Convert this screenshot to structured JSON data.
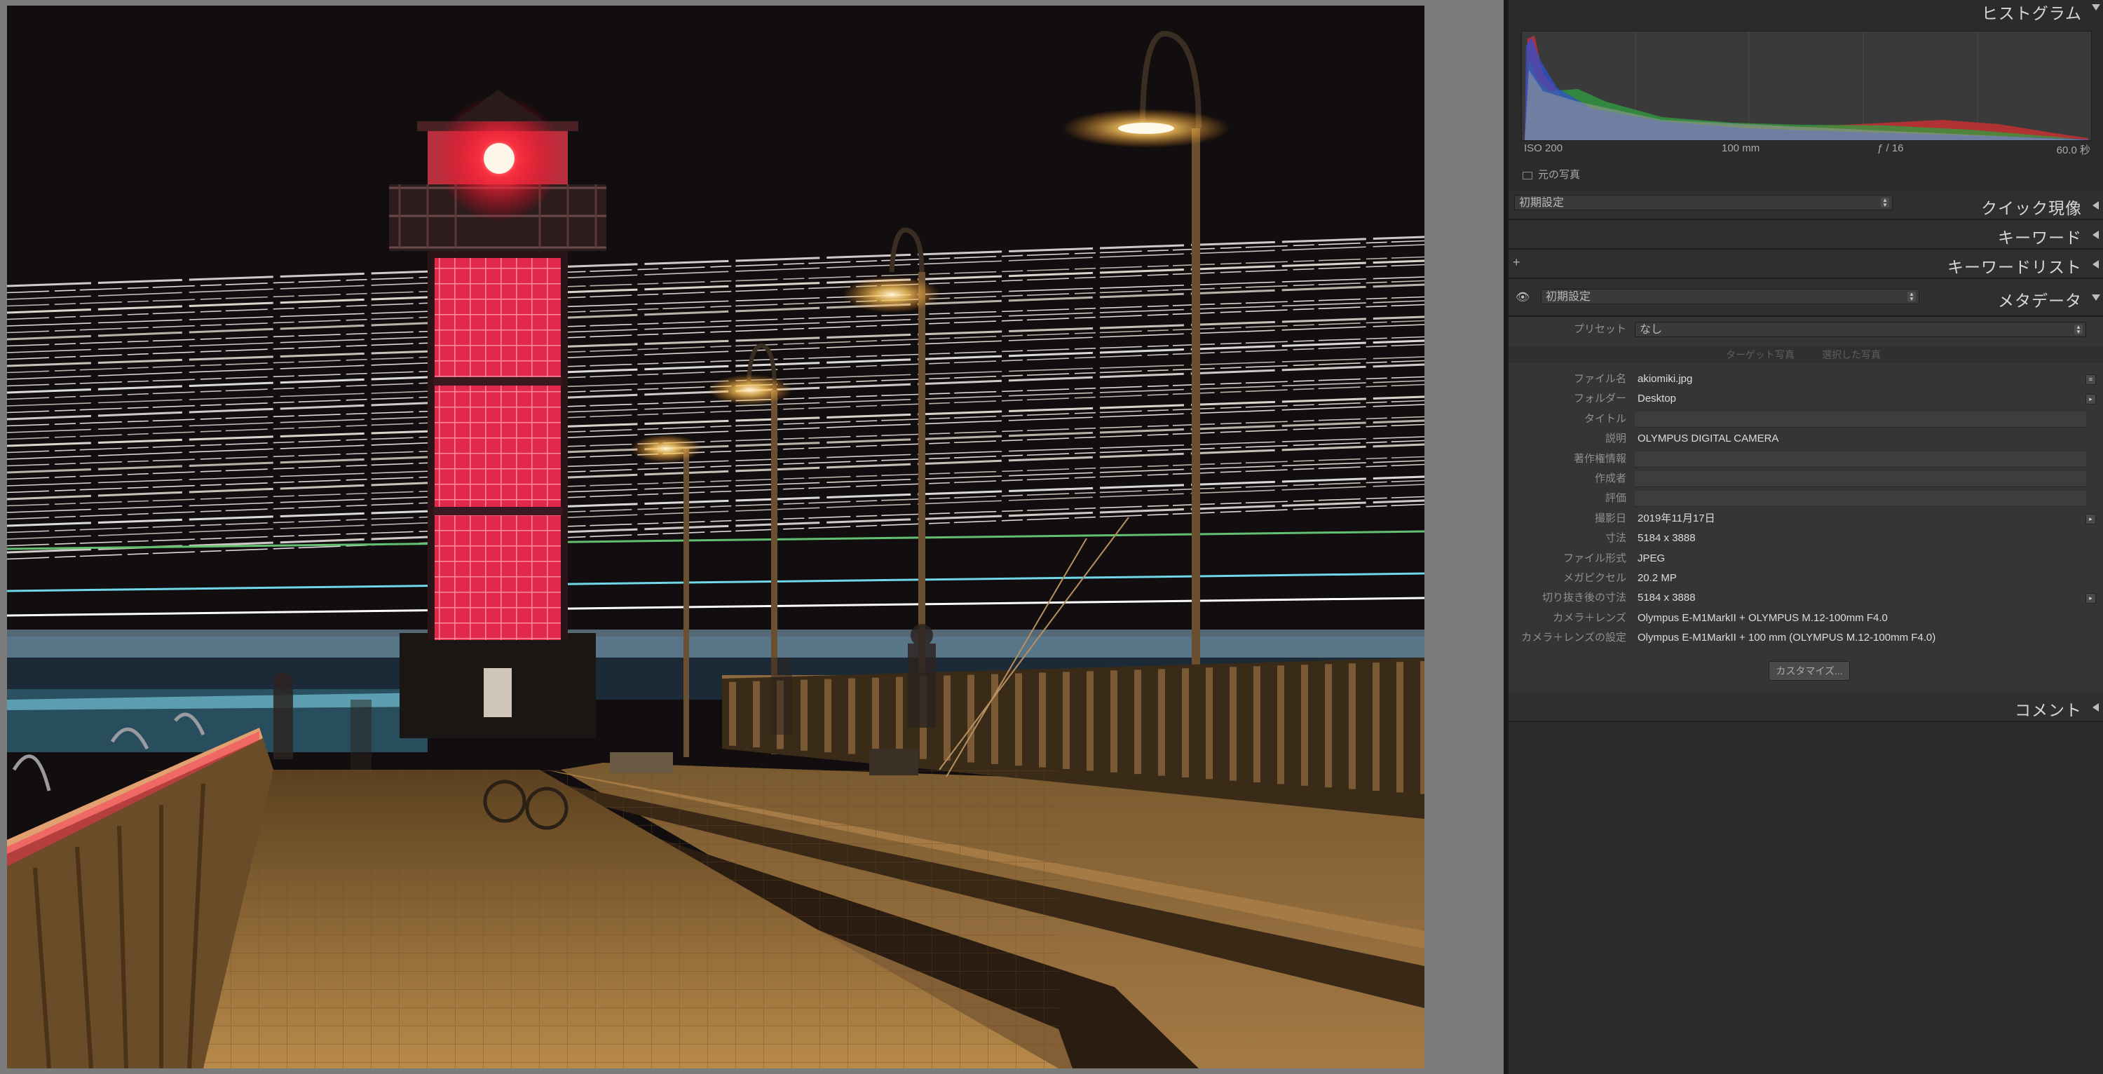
{
  "histogram": {
    "title": "ヒストグラム",
    "iso": "ISO 200",
    "focal": "100 mm",
    "aperture": "ƒ / 16",
    "shutter": "60.0 秒",
    "original_photo": "元の写真"
  },
  "quick_develop": {
    "preset_value": "初期設定",
    "title": "クイック現像"
  },
  "keywords": {
    "title": "キーワード"
  },
  "keyword_list": {
    "title": "キーワードリスト",
    "plus": "+"
  },
  "metadata": {
    "title": "メタデータ",
    "preset_select": "初期設定",
    "preset_label": "プリセット",
    "preset_value": "なし",
    "sync_left": "ターゲット写真",
    "sync_right": "選択した写真",
    "fields": [
      {
        "label": "ファイル名",
        "value": "akiomiki.jpg"
      },
      {
        "label": "フォルダー",
        "value": "Desktop"
      },
      {
        "label": "タイトル",
        "value": ""
      },
      {
        "label": "説明",
        "value": "OLYMPUS DIGITAL CAMERA"
      },
      {
        "label": "著作権情報",
        "value": ""
      },
      {
        "label": "作成者",
        "value": ""
      },
      {
        "label": "評価",
        "value": ""
      },
      {
        "label": "撮影日",
        "value": "2019年11月17日"
      },
      {
        "label": "寸法",
        "value": "5184 x 3888"
      },
      {
        "label": "ファイル形式",
        "value": "JPEG"
      },
      {
        "label": "メガピクセル",
        "value": "20.2 MP"
      },
      {
        "label": "切り抜き後の寸法",
        "value": "5184 x 3888"
      },
      {
        "label": "カメラ＋レンズ",
        "value": "Olympus E-M1MarkII + OLYMPUS M.12-100mm F4.0"
      },
      {
        "label": "カメラ＋レンズの設定",
        "value": "Olympus E-M1MarkII + 100 mm (OLYMPUS M.12-100mm F4.0)"
      }
    ],
    "customize": "カスタマイズ..."
  },
  "comments": {
    "title": "コメント"
  }
}
